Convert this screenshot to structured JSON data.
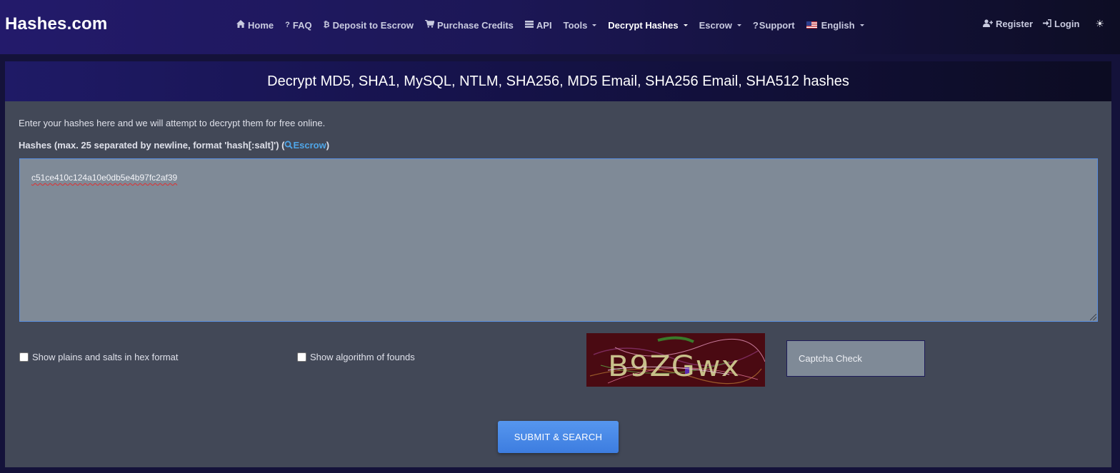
{
  "brand": "Hashes.com",
  "nav": {
    "items": [
      {
        "label": "Home",
        "icon": "home-icon"
      },
      {
        "label": "FAQ",
        "icon": "question-icon"
      },
      {
        "label": "Deposit to Escrow",
        "icon": "bitcoin-icon"
      },
      {
        "label": "Purchase Credits",
        "icon": "cart-icon"
      },
      {
        "label": "API",
        "icon": "server-icon"
      },
      {
        "label": "Tools",
        "dropdown": true
      },
      {
        "label": "Decrypt Hashes",
        "dropdown": true,
        "active": true
      },
      {
        "label": "Escrow",
        "dropdown": true
      },
      {
        "label": "Support",
        "icon": "question-icon"
      },
      {
        "label": "English",
        "icon": "us-flag-icon",
        "dropdown": true
      }
    ],
    "register": "Register",
    "login": "Login"
  },
  "panel": {
    "title": "Decrypt MD5, SHA1, MySQL, NTLM, SHA256, MD5 Email, SHA256 Email, SHA512 hashes",
    "intro": "Enter your hashes here and we will attempt to decrypt them for free online.",
    "hash_label": "Hashes (max. 25 separated by newline, format 'hash[:salt]') (",
    "escrow_link": "Escrow",
    "hash_label_end": ")",
    "hash_value": "c51ce410c124a10e0db5e4b97fc2af39",
    "checkbox_hex": "Show plains and salts in hex format",
    "checkbox_algorithm": "Show algorithm of founds",
    "captcha_text": "B9ZGwx",
    "captcha_placeholder": "Captcha Check",
    "submit_label": "SUBMIT & SEARCH"
  },
  "colors": {
    "accent": "#4fa6e8",
    "button": "#4a8ae8",
    "panel_bg": "#424857",
    "textarea_bg": "#7f8a97"
  }
}
